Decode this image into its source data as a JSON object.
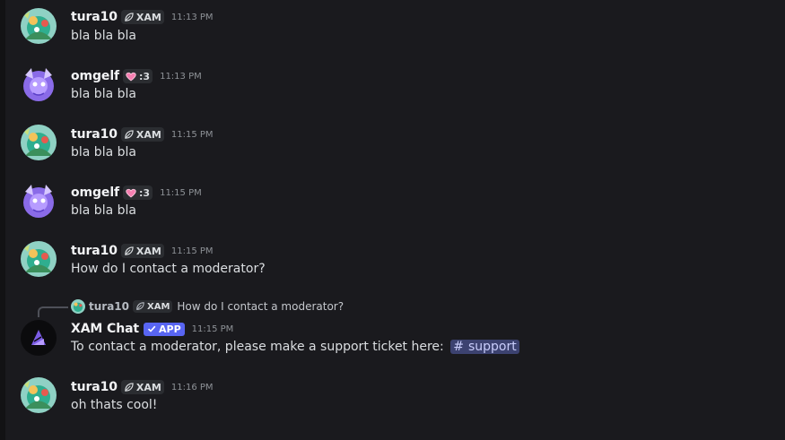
{
  "messages": [
    {
      "username": "tura10",
      "tag": "XAM",
      "time": "11:13 PM",
      "text": "bla bla bla"
    },
    {
      "username": "omgelf",
      "tag": ":3",
      "time": "11:13 PM",
      "text": "bla bla bla"
    },
    {
      "username": "tura10",
      "tag": "XAM",
      "time": "11:15 PM",
      "text": "bla bla bla"
    },
    {
      "username": "omgelf",
      "tag": ":3",
      "time": "11:15 PM",
      "text": "bla bla bla"
    },
    {
      "username": "tura10",
      "tag": "XAM",
      "time": "11:15 PM",
      "text": "How do I contact a moderator?"
    },
    {
      "username": "XAM Chat",
      "badge": "APP",
      "time": "11:15 PM",
      "text": "To contact a moderator, please make a support ticket here:",
      "channel_mention": "support",
      "reply": {
        "username": "tura10",
        "tag": "XAM",
        "text": "How do I contact a moderator?"
      }
    },
    {
      "username": "tura10",
      "tag": "XAM",
      "time": "11:16 PM",
      "text": "oh thats cool!"
    }
  ],
  "colors": {
    "background": "#1a1a1e",
    "app_badge": "#5865f2",
    "mention_bg": "#3c4270",
    "mention_text": "#c9cdfb"
  },
  "icons": {
    "tura10_tag": "leaf-icon",
    "omgelf_tag": "heart-icon",
    "app_badge": "check-icon",
    "channel": "hash-icon"
  }
}
